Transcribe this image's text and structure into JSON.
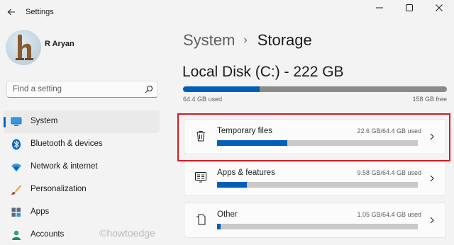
{
  "app": {
    "title": "Settings"
  },
  "profile": {
    "name": "R Aryan",
    "avatar_icon": "avatar-letter-h"
  },
  "search": {
    "placeholder": "Find a setting"
  },
  "nav": {
    "items": [
      {
        "label": "System",
        "icon": "monitor-icon",
        "active": true
      },
      {
        "label": "Bluetooth & devices",
        "icon": "bluetooth-icon",
        "active": false
      },
      {
        "label": "Network & internet",
        "icon": "wifi-icon",
        "active": false
      },
      {
        "label": "Personalization",
        "icon": "brush-icon",
        "active": false
      },
      {
        "label": "Apps",
        "icon": "apps-icon",
        "active": false
      },
      {
        "label": "Accounts",
        "icon": "person-icon",
        "active": false
      }
    ]
  },
  "breadcrumb": {
    "parent": "System",
    "separator": "›",
    "current": "Storage"
  },
  "disk": {
    "title": "Local Disk (C:) - 222 GB",
    "used_label": "64.4 GB used",
    "free_label": "158 GB free",
    "used_fraction": 0.29
  },
  "categories": [
    {
      "title": "Temporary files",
      "value": "22.6 GB/64.4 GB used",
      "icon": "trash-icon",
      "fraction": 0.35
    },
    {
      "title": "Apps & features",
      "value": "9.58 GB/64.4 GB used",
      "icon": "apps-features-icon",
      "fraction": 0.149
    },
    {
      "title": "Other",
      "value": "1.05 GB/64.4 GB used",
      "icon": "file-icon",
      "fraction": 0.016
    }
  ],
  "watermark": "©howtoedge",
  "colors": {
    "accent": "#005fb8",
    "highlight": "#d71920",
    "background": "#f3f3f3"
  }
}
